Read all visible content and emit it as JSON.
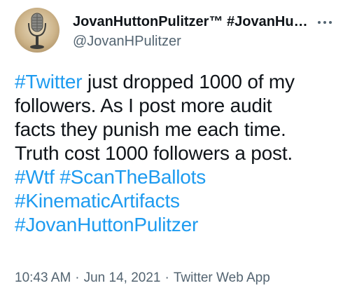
{
  "author": {
    "display_name": "JovanHuttonPulitzer™ #JovanHutto…",
    "handle": "@JovanHPulitzer"
  },
  "tweet": {
    "line1": {
      "tag": "#Twitter",
      "text": " just dropped 1000 of my"
    },
    "line2": "followers. As I post more audit",
    "line3": "facts they punish me each time.",
    "line4": "Truth cost 1000 followers a post.",
    "hashtags": [
      "#Wtf",
      "#ScanTheBallots",
      "#KinematicArtifacts",
      "#JovanHuttonPulitzer"
    ]
  },
  "meta": {
    "time": "10:43 AM",
    "date": "Jun 14, 2021",
    "source": "Twitter Web App",
    "separator": "·"
  },
  "icons": {
    "avatar": "vintage-microphone-icon",
    "more": "more-options-icon"
  },
  "colors": {
    "link": "#1d9bf0",
    "text": "#0f1419",
    "secondary": "#536471",
    "background": "#ffffff"
  }
}
